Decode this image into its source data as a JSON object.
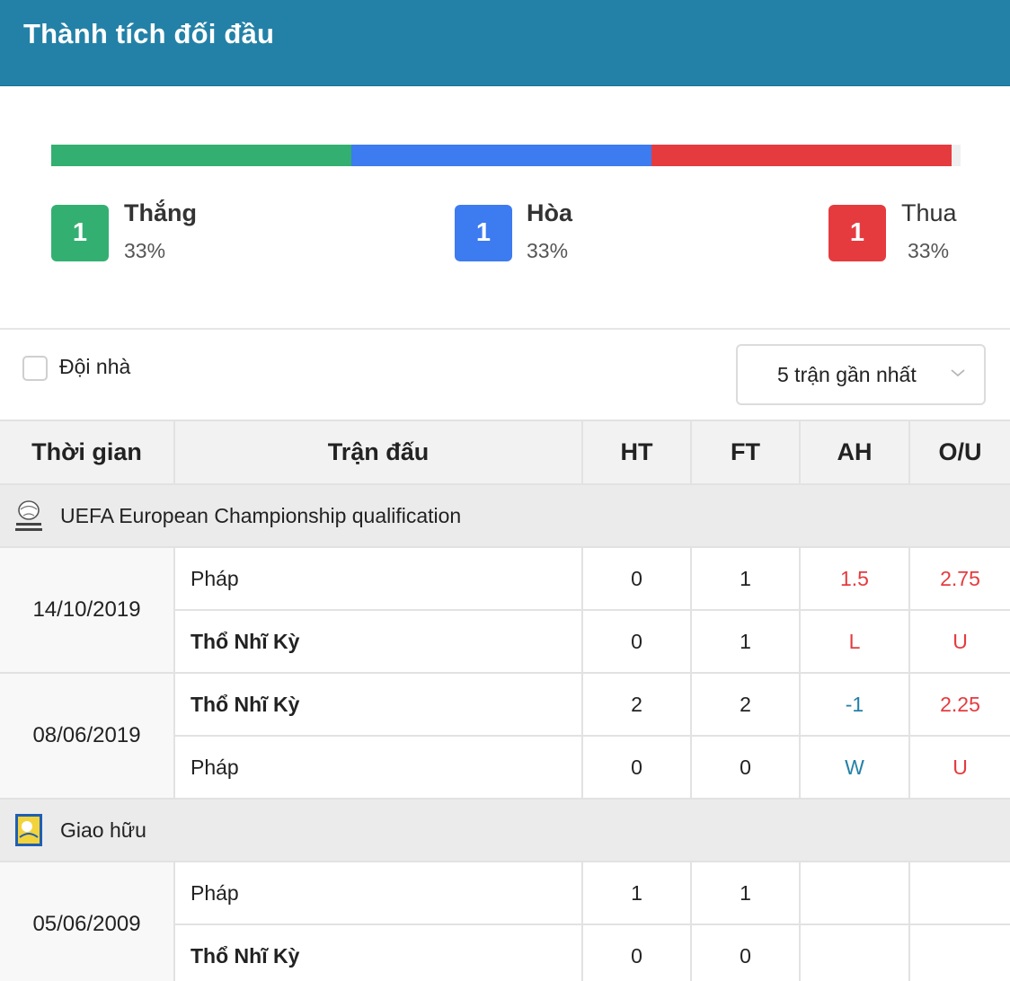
{
  "header": {
    "title": "Thành tích đối đầu"
  },
  "summary": {
    "win": {
      "count": "1",
      "label": "Thắng",
      "pct": "33%",
      "share": 0.333,
      "color": "#33b071"
    },
    "draw": {
      "count": "1",
      "label": "Hòa",
      "pct": "33%",
      "share": 0.333,
      "color": "#3d7bf0"
    },
    "lose": {
      "count": "1",
      "label": "Thua",
      "pct": "33%",
      "share": 0.333,
      "color": "#e53b3f"
    }
  },
  "filters": {
    "home_team_label": "Đội nhà",
    "home_team_checked": false,
    "match_count_select": "5 trận gần nhất"
  },
  "table": {
    "headers": {
      "time": "Thời gian",
      "match": "Trận đấu",
      "ht": "HT",
      "ft": "FT",
      "ah": "AH",
      "ou": "O/U"
    },
    "groups": [
      {
        "league": "UEFA European Championship qualification",
        "logo_icon": "uefa-euro-qualifiers-logo",
        "matches": [
          {
            "date": "14/10/2019",
            "rows": [
              {
                "team": "Pháp",
                "ht": "0",
                "ft": "1",
                "ah": "1.5",
                "ou": "2.75"
              },
              {
                "team": "Thổ Nhĩ Kỳ",
                "ht": "0",
                "ft": "1",
                "ah": "L",
                "ou": "U"
              }
            ]
          },
          {
            "date": "08/06/2019",
            "rows": [
              {
                "team": "Thổ Nhĩ Kỳ",
                "ht": "2",
                "ft": "2",
                "ah": "-1",
                "ou": "2.25"
              },
              {
                "team": "Pháp",
                "ht": "0",
                "ft": "0",
                "ah": "W",
                "ou": "U"
              }
            ]
          }
        ]
      },
      {
        "league": "Giao hữu",
        "logo_icon": "friendly-match-logo",
        "matches": [
          {
            "date": "05/06/2009",
            "rows": [
              {
                "team": "Pháp",
                "ht": "1",
                "ft": "1",
                "ah": "",
                "ou": ""
              },
              {
                "team": "Thổ Nhĩ Kỳ",
                "ht": "0",
                "ft": "0",
                "ah": "",
                "ou": ""
              }
            ]
          }
        ]
      }
    ]
  }
}
